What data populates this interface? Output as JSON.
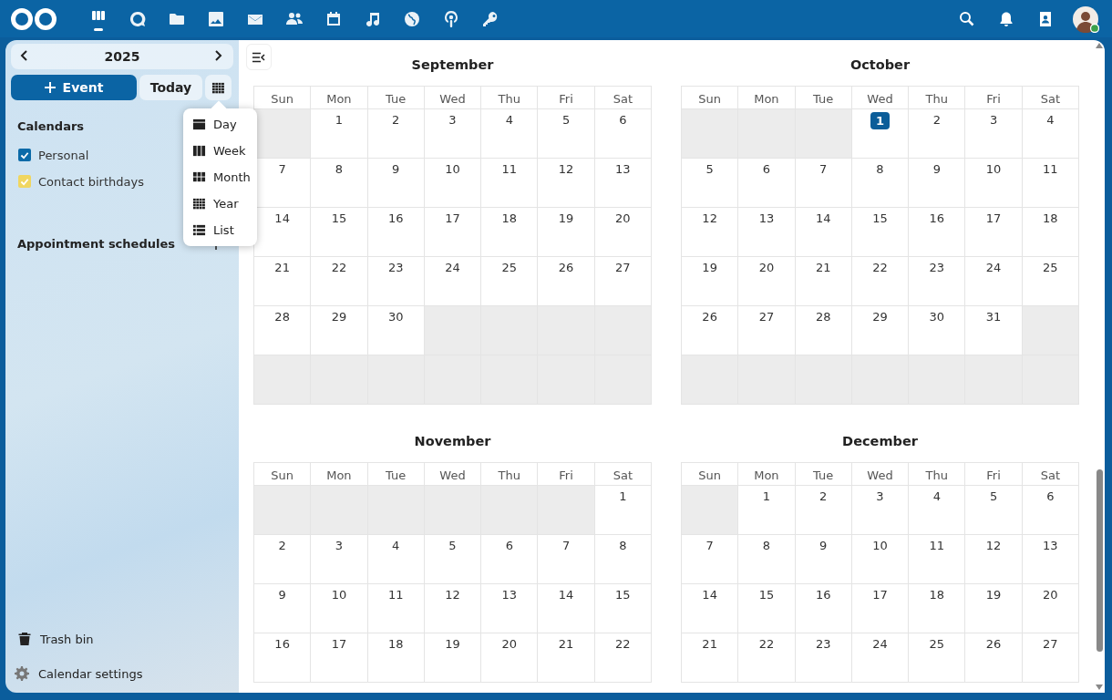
{
  "apps": [
    {
      "selected": true
    },
    {
      "selected": false
    },
    {
      "selected": false
    },
    {
      "selected": false
    },
    {
      "selected": false
    },
    {
      "selected": false
    },
    {
      "selected": false
    },
    {
      "selected": false
    },
    {
      "selected": false
    },
    {
      "selected": false
    },
    {
      "selected": false
    }
  ],
  "sidebar": {
    "year": "2025",
    "new_event": "Event",
    "today": "Today",
    "view_menu": [
      {
        "label": "Day"
      },
      {
        "label": "Week"
      },
      {
        "label": "Month"
      },
      {
        "label": "Year"
      },
      {
        "label": "List"
      }
    ],
    "calendars_heading": "Calendars",
    "calendars": [
      {
        "label": "Personal",
        "checked": true,
        "color": "#0b6aa8"
      },
      {
        "label": "Contact birthdays",
        "checked": true,
        "color": "#f0d660"
      }
    ],
    "appointments_heading": "Appointment schedules",
    "trash": "Trash bin",
    "settings": "Calendar settings"
  },
  "months": [
    {
      "name": "September",
      "weekdays": [
        "Sun",
        "Mon",
        "Tue",
        "Wed",
        "Thu",
        "Fri",
        "Sat"
      ],
      "weeks": [
        [
          {
            "kind": "blank"
          },
          {
            "kind": "day",
            "day": "1",
            "today": false
          },
          {
            "kind": "day",
            "day": "2",
            "today": false
          },
          {
            "kind": "day",
            "day": "3",
            "today": false
          },
          {
            "kind": "day",
            "day": "4",
            "today": false
          },
          {
            "kind": "day",
            "day": "5",
            "today": false
          },
          {
            "kind": "day",
            "day": "6",
            "today": false
          }
        ],
        [
          {
            "kind": "day",
            "day": "7",
            "today": false
          },
          {
            "kind": "day",
            "day": "8",
            "today": false
          },
          {
            "kind": "day",
            "day": "9",
            "today": false
          },
          {
            "kind": "day",
            "day": "10",
            "today": false
          },
          {
            "kind": "day",
            "day": "11",
            "today": false
          },
          {
            "kind": "day",
            "day": "12",
            "today": false
          },
          {
            "kind": "day",
            "day": "13",
            "today": false
          }
        ],
        [
          {
            "kind": "day",
            "day": "14",
            "today": false
          },
          {
            "kind": "day",
            "day": "15",
            "today": false
          },
          {
            "kind": "day",
            "day": "16",
            "today": false
          },
          {
            "kind": "day",
            "day": "17",
            "today": false
          },
          {
            "kind": "day",
            "day": "18",
            "today": false
          },
          {
            "kind": "day",
            "day": "19",
            "today": false
          },
          {
            "kind": "day",
            "day": "20",
            "today": false
          }
        ],
        [
          {
            "kind": "day",
            "day": "21",
            "today": false
          },
          {
            "kind": "day",
            "day": "22",
            "today": false
          },
          {
            "kind": "day",
            "day": "23",
            "today": false
          },
          {
            "kind": "day",
            "day": "24",
            "today": false
          },
          {
            "kind": "day",
            "day": "25",
            "today": false
          },
          {
            "kind": "day",
            "day": "26",
            "today": false
          },
          {
            "kind": "day",
            "day": "27",
            "today": false
          }
        ],
        [
          {
            "kind": "day",
            "day": "28",
            "today": false
          },
          {
            "kind": "day",
            "day": "29",
            "today": false
          },
          {
            "kind": "day",
            "day": "30",
            "today": false
          },
          {
            "kind": "blank"
          },
          {
            "kind": "blank"
          },
          {
            "kind": "blank"
          },
          {
            "kind": "blank"
          }
        ],
        [
          {
            "kind": "blank"
          },
          {
            "kind": "blank"
          },
          {
            "kind": "blank"
          },
          {
            "kind": "blank"
          },
          {
            "kind": "blank"
          },
          {
            "kind": "blank"
          },
          {
            "kind": "blank"
          }
        ]
      ]
    },
    {
      "name": "October",
      "weekdays": [
        "Sun",
        "Mon",
        "Tue",
        "Wed",
        "Thu",
        "Fri",
        "Sat"
      ],
      "weeks": [
        [
          {
            "kind": "blank"
          },
          {
            "kind": "blank"
          },
          {
            "kind": "blank"
          },
          {
            "kind": "day",
            "day": "1",
            "today": true
          },
          {
            "kind": "day",
            "day": "2",
            "today": false
          },
          {
            "kind": "day",
            "day": "3",
            "today": false
          },
          {
            "kind": "day",
            "day": "4",
            "today": false
          }
        ],
        [
          {
            "kind": "day",
            "day": "5",
            "today": false
          },
          {
            "kind": "day",
            "day": "6",
            "today": false
          },
          {
            "kind": "day",
            "day": "7",
            "today": false
          },
          {
            "kind": "day",
            "day": "8",
            "today": false
          },
          {
            "kind": "day",
            "day": "9",
            "today": false
          },
          {
            "kind": "day",
            "day": "10",
            "today": false
          },
          {
            "kind": "day",
            "day": "11",
            "today": false
          }
        ],
        [
          {
            "kind": "day",
            "day": "12",
            "today": false
          },
          {
            "kind": "day",
            "day": "13",
            "today": false
          },
          {
            "kind": "day",
            "day": "14",
            "today": false
          },
          {
            "kind": "day",
            "day": "15",
            "today": false
          },
          {
            "kind": "day",
            "day": "16",
            "today": false
          },
          {
            "kind": "day",
            "day": "17",
            "today": false
          },
          {
            "kind": "day",
            "day": "18",
            "today": false
          }
        ],
        [
          {
            "kind": "day",
            "day": "19",
            "today": false
          },
          {
            "kind": "day",
            "day": "20",
            "today": false
          },
          {
            "kind": "day",
            "day": "21",
            "today": false
          },
          {
            "kind": "day",
            "day": "22",
            "today": false
          },
          {
            "kind": "day",
            "day": "23",
            "today": false
          },
          {
            "kind": "day",
            "day": "24",
            "today": false
          },
          {
            "kind": "day",
            "day": "25",
            "today": false
          }
        ],
        [
          {
            "kind": "day",
            "day": "26",
            "today": false
          },
          {
            "kind": "day",
            "day": "27",
            "today": false
          },
          {
            "kind": "day",
            "day": "28",
            "today": false
          },
          {
            "kind": "day",
            "day": "29",
            "today": false
          },
          {
            "kind": "day",
            "day": "30",
            "today": false
          },
          {
            "kind": "day",
            "day": "31",
            "today": false
          },
          {
            "kind": "blank"
          }
        ],
        [
          {
            "kind": "blank"
          },
          {
            "kind": "blank"
          },
          {
            "kind": "blank"
          },
          {
            "kind": "blank"
          },
          {
            "kind": "blank"
          },
          {
            "kind": "blank"
          },
          {
            "kind": "blank"
          }
        ]
      ]
    },
    {
      "name": "November",
      "weekdays": [
        "Sun",
        "Mon",
        "Tue",
        "Wed",
        "Thu",
        "Fri",
        "Sat"
      ],
      "weeks": [
        [
          {
            "kind": "blank"
          },
          {
            "kind": "blank"
          },
          {
            "kind": "blank"
          },
          {
            "kind": "blank"
          },
          {
            "kind": "blank"
          },
          {
            "kind": "blank"
          },
          {
            "kind": "day",
            "day": "1",
            "today": false
          }
        ],
        [
          {
            "kind": "day",
            "day": "2",
            "today": false
          },
          {
            "kind": "day",
            "day": "3",
            "today": false
          },
          {
            "kind": "day",
            "day": "4",
            "today": false
          },
          {
            "kind": "day",
            "day": "5",
            "today": false
          },
          {
            "kind": "day",
            "day": "6",
            "today": false
          },
          {
            "kind": "day",
            "day": "7",
            "today": false
          },
          {
            "kind": "day",
            "day": "8",
            "today": false
          }
        ],
        [
          {
            "kind": "day",
            "day": "9",
            "today": false
          },
          {
            "kind": "day",
            "day": "10",
            "today": false
          },
          {
            "kind": "day",
            "day": "11",
            "today": false
          },
          {
            "kind": "day",
            "day": "12",
            "today": false
          },
          {
            "kind": "day",
            "day": "13",
            "today": false
          },
          {
            "kind": "day",
            "day": "14",
            "today": false
          },
          {
            "kind": "day",
            "day": "15",
            "today": false
          }
        ],
        [
          {
            "kind": "day",
            "day": "16",
            "today": false
          },
          {
            "kind": "day",
            "day": "17",
            "today": false
          },
          {
            "kind": "day",
            "day": "18",
            "today": false
          },
          {
            "kind": "day",
            "day": "19",
            "today": false
          },
          {
            "kind": "day",
            "day": "20",
            "today": false
          },
          {
            "kind": "day",
            "day": "21",
            "today": false
          },
          {
            "kind": "day",
            "day": "22",
            "today": false
          }
        ]
      ]
    },
    {
      "name": "December",
      "weekdays": [
        "Sun",
        "Mon",
        "Tue",
        "Wed",
        "Thu",
        "Fri",
        "Sat"
      ],
      "weeks": [
        [
          {
            "kind": "blank"
          },
          {
            "kind": "day",
            "day": "1",
            "today": false
          },
          {
            "kind": "day",
            "day": "2",
            "today": false
          },
          {
            "kind": "day",
            "day": "3",
            "today": false
          },
          {
            "kind": "day",
            "day": "4",
            "today": false
          },
          {
            "kind": "day",
            "day": "5",
            "today": false
          },
          {
            "kind": "day",
            "day": "6",
            "today": false
          }
        ],
        [
          {
            "kind": "day",
            "day": "7",
            "today": false
          },
          {
            "kind": "day",
            "day": "8",
            "today": false
          },
          {
            "kind": "day",
            "day": "9",
            "today": false
          },
          {
            "kind": "day",
            "day": "10",
            "today": false
          },
          {
            "kind": "day",
            "day": "11",
            "today": false
          },
          {
            "kind": "day",
            "day": "12",
            "today": false
          },
          {
            "kind": "day",
            "day": "13",
            "today": false
          }
        ],
        [
          {
            "kind": "day",
            "day": "14",
            "today": false
          },
          {
            "kind": "day",
            "day": "15",
            "today": false
          },
          {
            "kind": "day",
            "day": "16",
            "today": false
          },
          {
            "kind": "day",
            "day": "17",
            "today": false
          },
          {
            "kind": "day",
            "day": "18",
            "today": false
          },
          {
            "kind": "day",
            "day": "19",
            "today": false
          },
          {
            "kind": "day",
            "day": "20",
            "today": false
          }
        ],
        [
          {
            "kind": "day",
            "day": "21",
            "today": false
          },
          {
            "kind": "day",
            "day": "22",
            "today": false
          },
          {
            "kind": "day",
            "day": "23",
            "today": false
          },
          {
            "kind": "day",
            "day": "24",
            "today": false
          },
          {
            "kind": "day",
            "day": "25",
            "today": false
          },
          {
            "kind": "day",
            "day": "26",
            "today": false
          },
          {
            "kind": "day",
            "day": "27",
            "today": false
          }
        ]
      ]
    }
  ]
}
